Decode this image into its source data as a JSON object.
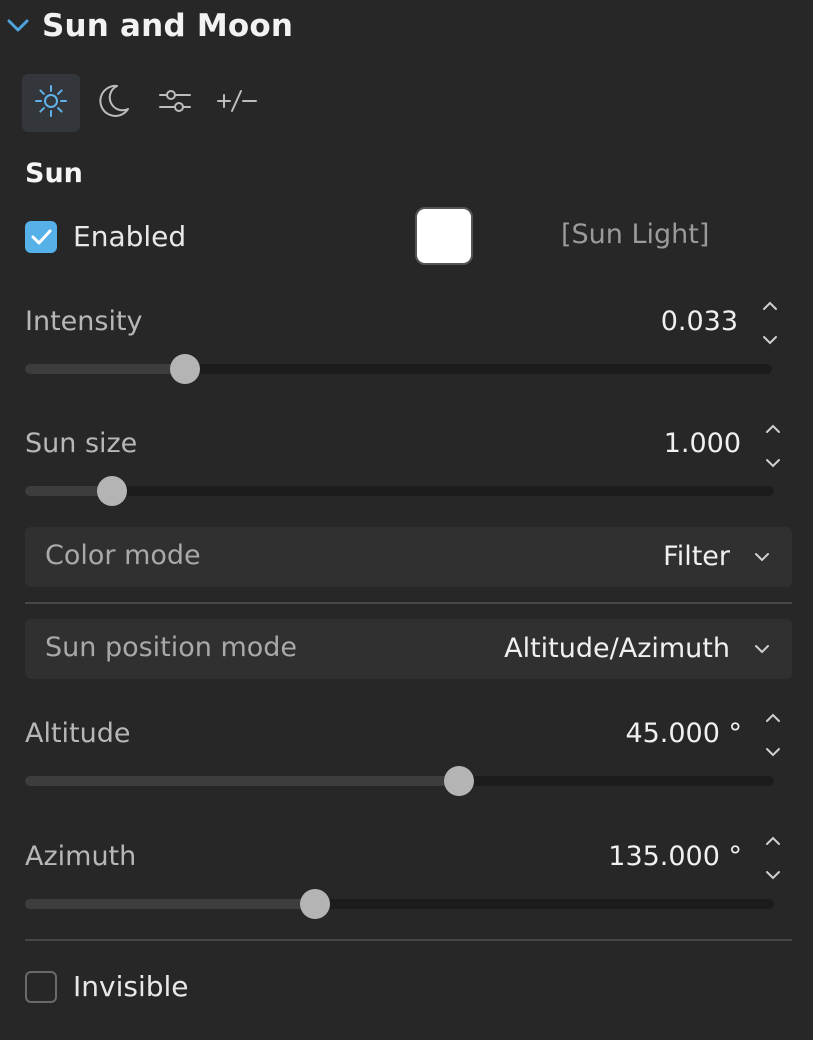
{
  "header": {
    "title": "Sun and Moon"
  },
  "tabs": [
    {
      "icon": "sun-icon",
      "active": true
    },
    {
      "icon": "moon-icon",
      "active": false
    },
    {
      "icon": "sliders-icon",
      "active": false
    },
    {
      "icon": "plus-minus-icon",
      "active": false
    }
  ],
  "sun": {
    "section_title": "Sun",
    "enabled_label": "Enabled",
    "enabled": true,
    "color": "#ffffff",
    "light_link": "[Sun Light]",
    "intensity": {
      "label": "Intensity",
      "value": "0.033",
      "slider_fraction": 0.214
    },
    "sun_size": {
      "label": "Sun size",
      "value": "1.000",
      "slider_fraction": 0.116
    },
    "color_mode": {
      "label": "Color mode",
      "value": "Filter"
    },
    "position_mode": {
      "label": "Sun position mode",
      "value": "Altitude/Azimuth"
    },
    "altitude": {
      "label": "Altitude",
      "value": "45.000 °",
      "slider_fraction": 0.58
    },
    "azimuth": {
      "label": "Azimuth",
      "value": "135.000 °",
      "slider_fraction": 0.387
    },
    "invisible_label": "Invisible",
    "invisible": false
  },
  "colors": {
    "accent": "#55b1e8",
    "background": "#272727",
    "slider_thumb": "#b4b4b4"
  }
}
